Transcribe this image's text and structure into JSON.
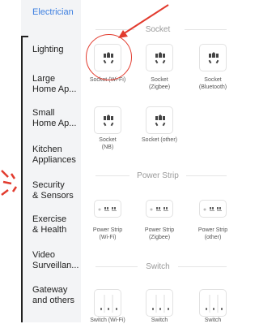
{
  "sidebar": {
    "items": [
      {
        "label": "Electrician",
        "active": true
      },
      {
        "label": "Lighting"
      },
      {
        "label": "Large\nHome Ap..."
      },
      {
        "label": "Small\nHome Ap..."
      },
      {
        "label": "Kitchen\nAppliances"
      },
      {
        "label": "Security\n& Sensors"
      },
      {
        "label": "Exercise\n& Health"
      },
      {
        "label": "Video\nSurveillan..."
      },
      {
        "label": "Gateway\nand others"
      }
    ]
  },
  "sections": {
    "socket": {
      "title": "Socket",
      "items": [
        {
          "label": "Socket (Wi-Fi)"
        },
        {
          "label": "Socket\n(Zigbee)"
        },
        {
          "label": "Socket\n(Bluetooth)"
        },
        {
          "label": "Socket\n(NB)"
        },
        {
          "label": "Socket (other)"
        }
      ]
    },
    "power_strip": {
      "title": "Power Strip",
      "items": [
        {
          "label": "Power Strip\n(Wi-Fi)"
        },
        {
          "label": "Power Strip\n(Zigbee)"
        },
        {
          "label": "Power Strip\n(other)"
        }
      ]
    },
    "switch": {
      "title": "Switch",
      "items": [
        {
          "label": "Switch (Wi-Fi)"
        },
        {
          "label": "Switch"
        },
        {
          "label": "Switch"
        }
      ]
    }
  },
  "colors": {
    "accent": "#3d7fe0",
    "annotation": "#e23b2e"
  }
}
